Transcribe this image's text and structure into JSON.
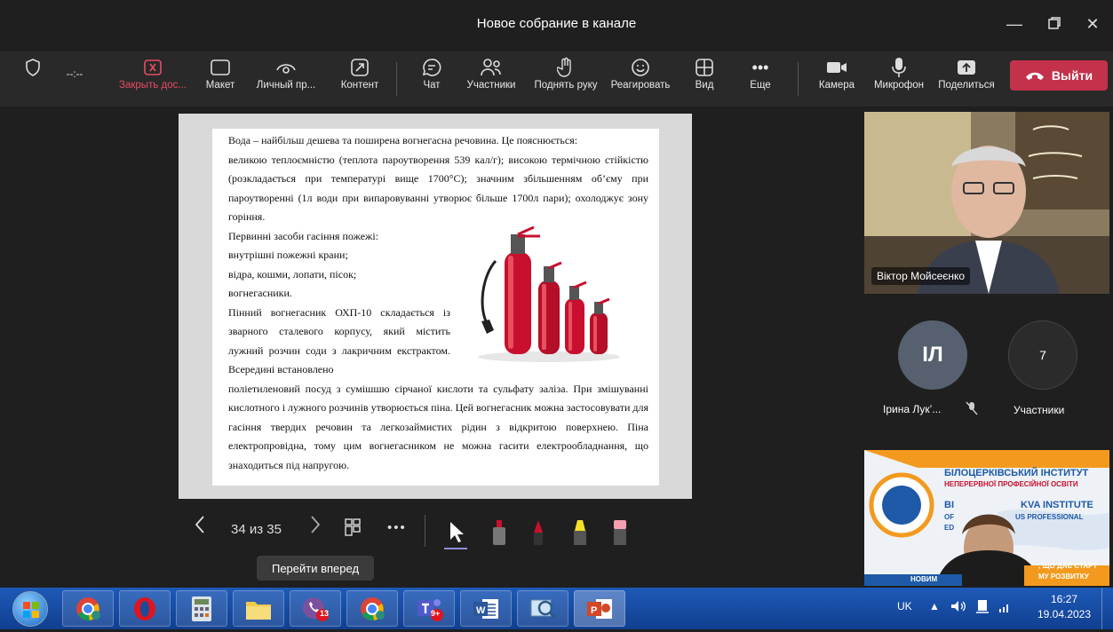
{
  "window": {
    "title": "Новое собрание в канале"
  },
  "toolbar": {
    "timer": "--:--",
    "items": [
      {
        "label": "Закрыть дос...",
        "icon": "close-box-icon"
      },
      {
        "label": "Макет",
        "icon": "layout-icon"
      },
      {
        "label": "Личный пр...",
        "icon": "eye-icon"
      },
      {
        "label": "Контент",
        "icon": "share-content-icon"
      },
      {
        "label": "Чат",
        "icon": "chat-icon"
      },
      {
        "label": "Участники",
        "icon": "people-icon"
      },
      {
        "label": "Поднять руку",
        "icon": "hand-icon"
      },
      {
        "label": "Реагировать",
        "icon": "smile-icon"
      },
      {
        "label": "Вид",
        "icon": "grid-icon"
      },
      {
        "label": "Еще",
        "icon": "more-icon"
      },
      {
        "label": "Камера",
        "icon": "camera-icon"
      },
      {
        "label": "Микрофон",
        "icon": "mic-icon"
      },
      {
        "label": "Поделиться",
        "icon": "share-icon"
      }
    ],
    "leave_label": "Выйти"
  },
  "slide": {
    "p1": "Вода – найбільш дешева та поширена вогнегасна речовина. Це пояснюється:",
    "p2": "великою теплоємністю (теплота пароутворення 539 кал/г); високою термічною стійкістю (розкладається при температурі вище 1700°С); значним збільшенням об’єму при пароутворенні (1л води при випаровуванні утворює більше 1700л пари); охолоджує зону горіння.",
    "p3": "Первинні засоби гасіння пожежі:",
    "p4": "внутрішні пожежні крани;",
    "p5": "відра, кошми, лопати, пісок;",
    "p6": "вогнегасники.",
    "p7": "Пінний вогнегасник ОХП-10 складається із зварного сталевого корпусу, який містить лужний розчин соди з лакричним екстрактом. Всередині встановлено",
    "p8": "поліетиленовий посуд з сумішшю сірчаної кислоти та сульфату заліза. При змішуванні кислотного і лужного розчинів утворюється піна. Цей вогнегасник можна застосовувати для гасіння твердих речовин та легкозаймистих рідин з відкритою поверхнею. Піна електропровідна, тому цим вогнегасником не можна гасити електрообладнання, що знаходиться під напругою."
  },
  "slide_nav": {
    "counter": "34 из 35",
    "tooltip": "Перейти вперед"
  },
  "participants": {
    "speaker_name": "Віктор Мойсеєнко",
    "avatar_initials": "ІЛ",
    "avatar_name": "Ірина Лук’...",
    "count": "7",
    "count_label": "Участники"
  },
  "banner": {
    "line1": "БІЛОЦЕРКІВСЬКИЙ ІНСТИТУТ",
    "line2": "НЕПЕРЕРВНОЇ ПРОФЕСІЙНОЇ ОСВІТИ",
    "line3": "BI",
    "line4": "KVA INSTITUTE",
    "line5": "OF",
    "line6": "US PROFESSIONAL",
    "line7": "ED",
    "line8": ", ЩО ДАЄ СТАРТ",
    "line9": "НОВИМ",
    "line10": "МУ РОЗВИТКУ"
  },
  "taskbar": {
    "badge_viber": "13",
    "badge_teams": "9+",
    "lang": "UK",
    "time": "16:27",
    "date": "19.04.2023"
  },
  "colors": {
    "accent_red": "#c4314b",
    "bg_dark": "#1f1f1f",
    "toolbar": "#292929"
  }
}
